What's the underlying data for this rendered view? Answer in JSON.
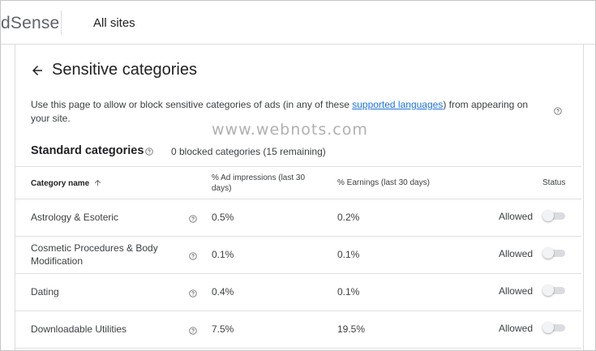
{
  "topbar": {
    "brand": "dSense",
    "site_selector": "All sites"
  },
  "page": {
    "title": "Sensitive categories",
    "description_before": "Use this page to allow or block sensitive categories of ads (in any of these ",
    "description_link": "supported languages",
    "description_after": ") from appearing on your site."
  },
  "watermark": "www.webnots.com",
  "standard": {
    "title": "Standard categories",
    "count_text": "0 blocked categories (15 remaining)"
  },
  "table": {
    "headers": {
      "category": "Category name",
      "impressions": "% Ad impressions (last 30 days)",
      "earnings": "% Earnings (last 30 days)",
      "status": "Status"
    },
    "rows": [
      {
        "name": "Astrology & Esoteric",
        "impressions": "0.5%",
        "earnings": "0.2%",
        "status": "Allowed",
        "enabled": false
      },
      {
        "name": "Cosmetic Procedures & Body Modification",
        "impressions": "0.1%",
        "earnings": "0.1%",
        "status": "Allowed",
        "enabled": false
      },
      {
        "name": "Dating",
        "impressions": "0.4%",
        "earnings": "0.1%",
        "status": "Allowed",
        "enabled": false
      },
      {
        "name": "Downloadable Utilities",
        "impressions": "7.5%",
        "earnings": "19.5%",
        "status": "Allowed",
        "enabled": false
      }
    ]
  },
  "colors": {
    "link": "#1a73e8",
    "divider": "#dadce0",
    "toggle_track": "#dadce0",
    "toggle_knob": "#f1f3f4"
  }
}
